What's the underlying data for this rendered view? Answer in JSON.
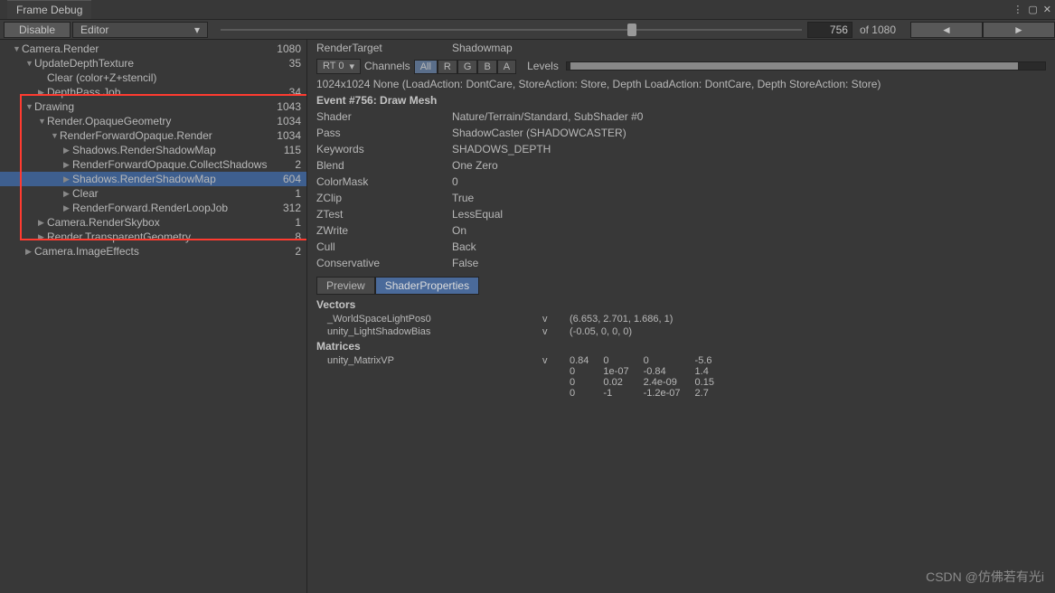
{
  "window": {
    "title": "Frame Debug"
  },
  "toolbar": {
    "disable_label": "Disable",
    "target_label": "Editor",
    "current_frame": "756",
    "total_frames": "1080",
    "of_label": "of"
  },
  "tree": [
    {
      "indent": 1,
      "icon": "down",
      "label": "Camera.Render",
      "count": "1080"
    },
    {
      "indent": 2,
      "icon": "down",
      "label": "UpdateDepthTexture",
      "count": "35"
    },
    {
      "indent": 3,
      "icon": "",
      "label": "Clear (color+Z+stencil)",
      "count": ""
    },
    {
      "indent": 3,
      "icon": "right",
      "label": "DepthPass.Job",
      "count": "34"
    },
    {
      "indent": 2,
      "icon": "down",
      "label": "Drawing",
      "count": "1043"
    },
    {
      "indent": 3,
      "icon": "down",
      "label": "Render.OpaqueGeometry",
      "count": "1034"
    },
    {
      "indent": 4,
      "icon": "down",
      "label": "RenderForwardOpaque.Render",
      "count": "1034"
    },
    {
      "indent": 5,
      "icon": "right",
      "label": "Shadows.RenderShadowMap",
      "count": "115"
    },
    {
      "indent": 5,
      "icon": "right",
      "label": "RenderForwardOpaque.CollectShadows",
      "count": "2"
    },
    {
      "indent": 5,
      "icon": "right",
      "label": "Shadows.RenderShadowMap",
      "count": "604",
      "selected": true
    },
    {
      "indent": 5,
      "icon": "right",
      "label": "Clear",
      "count": "1"
    },
    {
      "indent": 5,
      "icon": "right",
      "label": "RenderForward.RenderLoopJob",
      "count": "312"
    },
    {
      "indent": 3,
      "icon": "right",
      "label": "Camera.RenderSkybox",
      "count": "1"
    },
    {
      "indent": 3,
      "icon": "right",
      "label": "Render.TransparentGeometry",
      "count": "8"
    },
    {
      "indent": 2,
      "icon": "right",
      "label": "Camera.ImageEffects",
      "count": "2"
    }
  ],
  "detail": {
    "render_target_label": "RenderTarget",
    "render_target_value": "Shadowmap",
    "rt_dropdown": "RT 0",
    "channels_label": "Channels",
    "channels": [
      "All",
      "R",
      "G",
      "B",
      "A"
    ],
    "levels_label": "Levels",
    "info_line": "1024x1024 None (LoadAction: DontCare, StoreAction: Store, Depth LoadAction: DontCare, Depth StoreAction: Store)",
    "event_title": "Event #756: Draw Mesh",
    "rows": [
      {
        "k": "Shader",
        "v": "Nature/Terrain/Standard, SubShader #0"
      },
      {
        "k": "Pass",
        "v": "ShadowCaster (SHADOWCASTER)"
      },
      {
        "k": "Keywords",
        "v": "SHADOWS_DEPTH"
      },
      {
        "k": "Blend",
        "v": "One Zero"
      },
      {
        "k": "ColorMask",
        "v": "0"
      },
      {
        "k": "ZClip",
        "v": "True"
      },
      {
        "k": "ZTest",
        "v": "LessEqual"
      },
      {
        "k": "ZWrite",
        "v": "On"
      },
      {
        "k": "Cull",
        "v": "Back"
      },
      {
        "k": "Conservative",
        "v": "False"
      }
    ],
    "tabs": {
      "preview": "Preview",
      "shader_props": "ShaderProperties"
    },
    "vectors_heading": "Vectors",
    "vectors": [
      {
        "name": "_WorldSpaceLightPos0",
        "type": "v",
        "val": "(6.653, 2.701, 1.686, 1)"
      },
      {
        "name": "unity_LightShadowBias",
        "type": "v",
        "val": "(-0.05, 0, 0, 0)"
      }
    ],
    "matrices_heading": "Matrices",
    "matrix_name": "unity_MatrixVP",
    "matrix_type": "v",
    "matrix": [
      [
        "0.84",
        "0",
        "0",
        "-5.6"
      ],
      [
        "0",
        "1e-07",
        "-0.84",
        "1.4"
      ],
      [
        "0",
        "0.02",
        "2.4e-09",
        "0.15"
      ],
      [
        "0",
        "-1",
        "-1.2e-07",
        "2.7"
      ]
    ]
  },
  "watermark": "CSDN @仿佛若有光i"
}
